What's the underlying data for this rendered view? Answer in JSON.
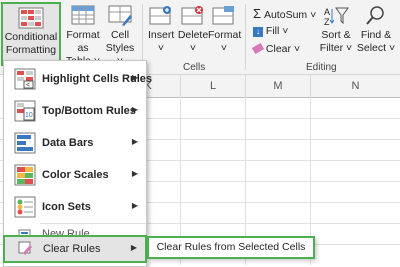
{
  "ribbon": {
    "conditional_formatting": {
      "line1": "Conditional",
      "line2": "Formatting"
    },
    "format_as_table": {
      "line1": "Format as",
      "line2": "Table"
    },
    "cell_styles": {
      "line1": "Cell",
      "line2": "Styles"
    },
    "insert": "Insert",
    "delete": "Delete",
    "format": "Format",
    "cells_group": "Cells",
    "autosum": "AutoSum",
    "fill": "Fill",
    "clear": "Clear",
    "sort_filter": {
      "line1": "Sort &",
      "line2": "Filter"
    },
    "find_select": {
      "line1": "Find &",
      "line2": "Select"
    },
    "editing_group": "Editing"
  },
  "columns": [
    "K",
    "L",
    "M",
    "N"
  ],
  "menu": {
    "items": [
      {
        "label": "Highlight Cells Rules",
        "icon": "highlight-cells-icon"
      },
      {
        "label": "Top/Bottom Rules",
        "icon": "top-bottom-icon"
      },
      {
        "label": "Data Bars",
        "icon": "data-bars-icon"
      },
      {
        "label": "Color Scales",
        "icon": "color-scales-icon"
      },
      {
        "label": "Icon Sets",
        "icon": "icon-sets-icon"
      }
    ],
    "new_rule": "New Rule...",
    "clear_rules": "Clear Rules"
  },
  "submenu": {
    "clear_selected": "Clear Rules from Selected Cells"
  },
  "colors": {
    "green_highlight": "#4caf50",
    "ribbon_bg": "#f3f3f3"
  }
}
